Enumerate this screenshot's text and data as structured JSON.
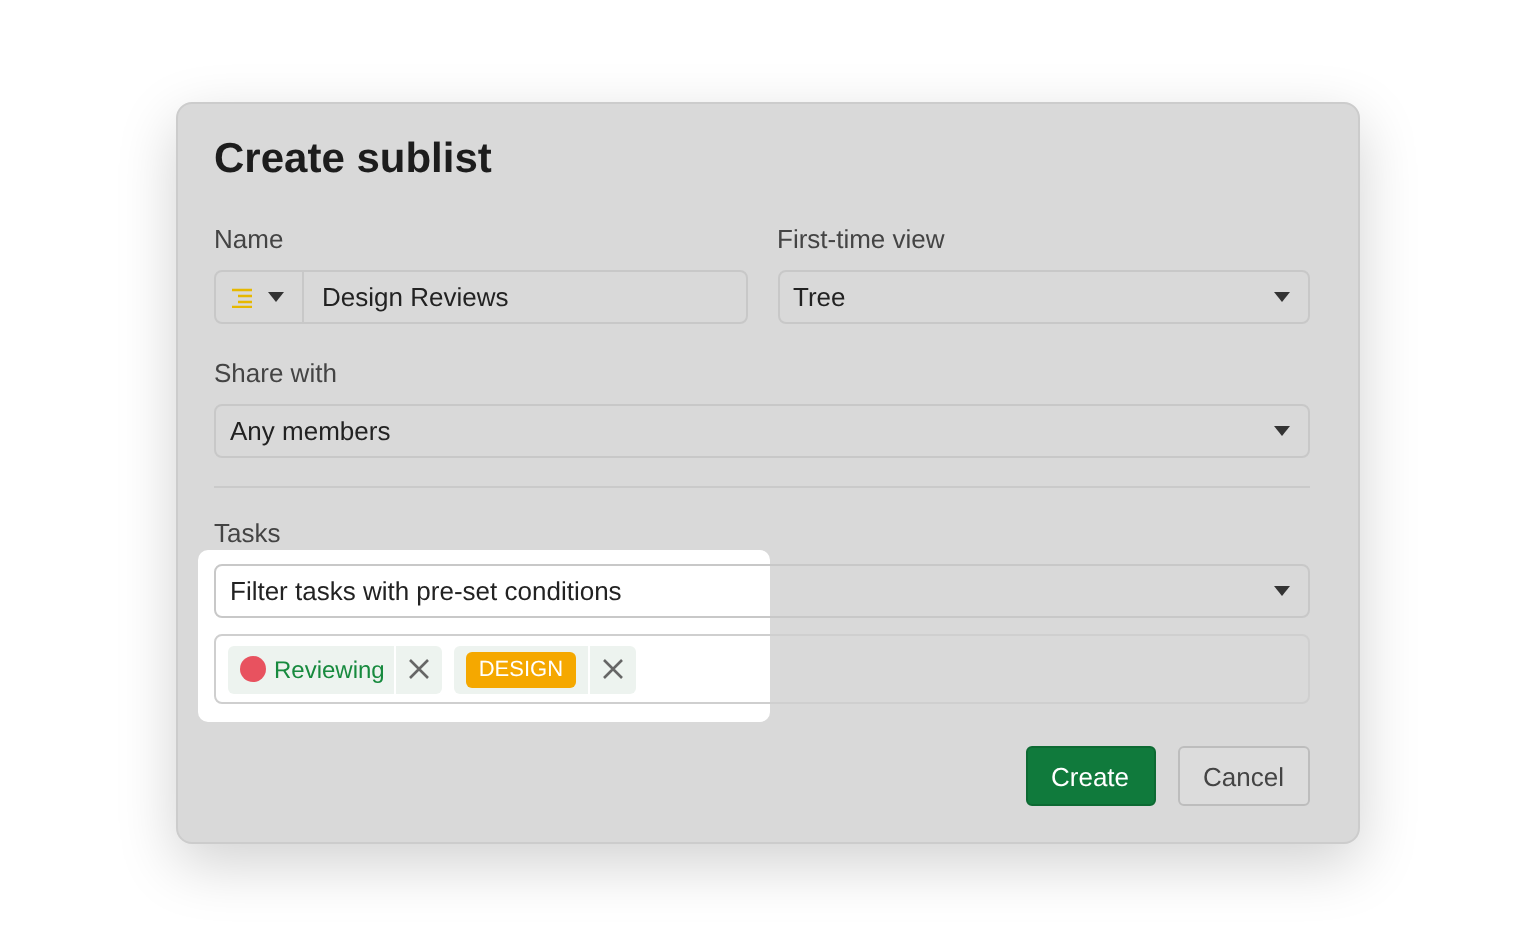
{
  "dialog": {
    "title": "Create sublist",
    "name": {
      "label": "Name",
      "value": "Design Reviews"
    },
    "first_time_view": {
      "label": "First-time view",
      "value": "Tree"
    },
    "share_with": {
      "label": "Share with",
      "value": "Any members"
    },
    "tasks": {
      "label": "Tasks",
      "filter": "Filter tasks with pre-set conditions",
      "conditions": [
        {
          "kind": "status",
          "label": "Reviewing",
          "color": "#e8525f"
        },
        {
          "kind": "tag",
          "label": "DESIGN",
          "color": "#f5a800"
        }
      ]
    },
    "buttons": [
      {
        "label": "Create",
        "kind": "primary"
      },
      {
        "label": "Cancel",
        "kind": "secondary"
      }
    ]
  }
}
